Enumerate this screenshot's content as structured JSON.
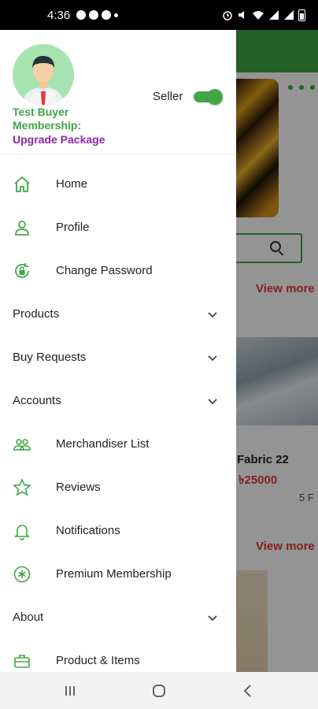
{
  "status_bar": {
    "time": "4:36"
  },
  "drawer": {
    "user_name": "Test Buyer",
    "membership_label": "Membership:",
    "upgrade_label": "Upgrade Package",
    "seller_label": "Seller",
    "seller_toggle_on": true,
    "menu": [
      {
        "label": "Home",
        "icon": "home-icon"
      },
      {
        "label": "Profile",
        "icon": "person-icon"
      },
      {
        "label": "Change Password",
        "icon": "lock-refresh-icon"
      },
      {
        "label": "Products",
        "section": true
      },
      {
        "label": "Buy Requests",
        "section": true
      },
      {
        "label": "Accounts",
        "section": true
      },
      {
        "label": "Merchandiser List",
        "icon": "group-icon"
      },
      {
        "label": "Reviews",
        "icon": "star-icon"
      },
      {
        "label": "Notifications",
        "icon": "bell-icon"
      },
      {
        "label": "Premium Membership",
        "icon": "asterisk-circle-icon"
      },
      {
        "label": "About",
        "section": true
      },
      {
        "label": "Product & Items",
        "icon": "briefcase-icon"
      }
    ]
  },
  "background": {
    "view_more_1": "View more",
    "view_more_2": "View more",
    "product_name": "Fabric 22",
    "product_price": "৳25000",
    "product_extra": "5 F"
  },
  "colors": {
    "brand_green": "#3fa845",
    "upgrade_purple": "#8e24aa",
    "price_red": "#e53935"
  }
}
